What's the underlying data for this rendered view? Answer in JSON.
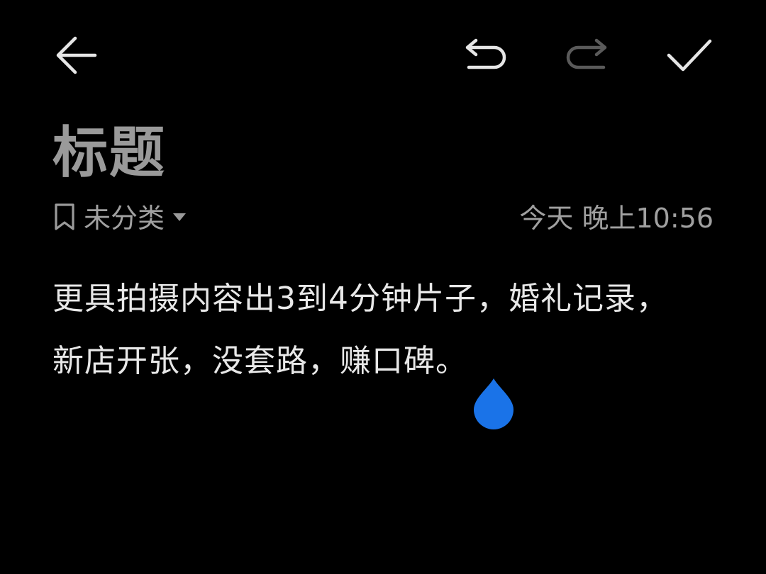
{
  "toolbar": {
    "back_icon": "arrow-left-icon",
    "undo_icon": "undo-icon",
    "redo_icon": "redo-icon",
    "done_icon": "checkmark-icon"
  },
  "note": {
    "title": "标题",
    "category": "未分类",
    "timestamp": "今天 晚上10:56",
    "body_lines": [
      "更具拍摄内容出3到4分钟片子，婚礼记录，",
      "新店开张，没套路，赚口碑。"
    ]
  },
  "colors": {
    "background": "#000000",
    "text": "#e8e8e8",
    "muted": "#a0a0a0",
    "disabled_icon": "#5a5a5a",
    "accent": "#1a73e8"
  }
}
